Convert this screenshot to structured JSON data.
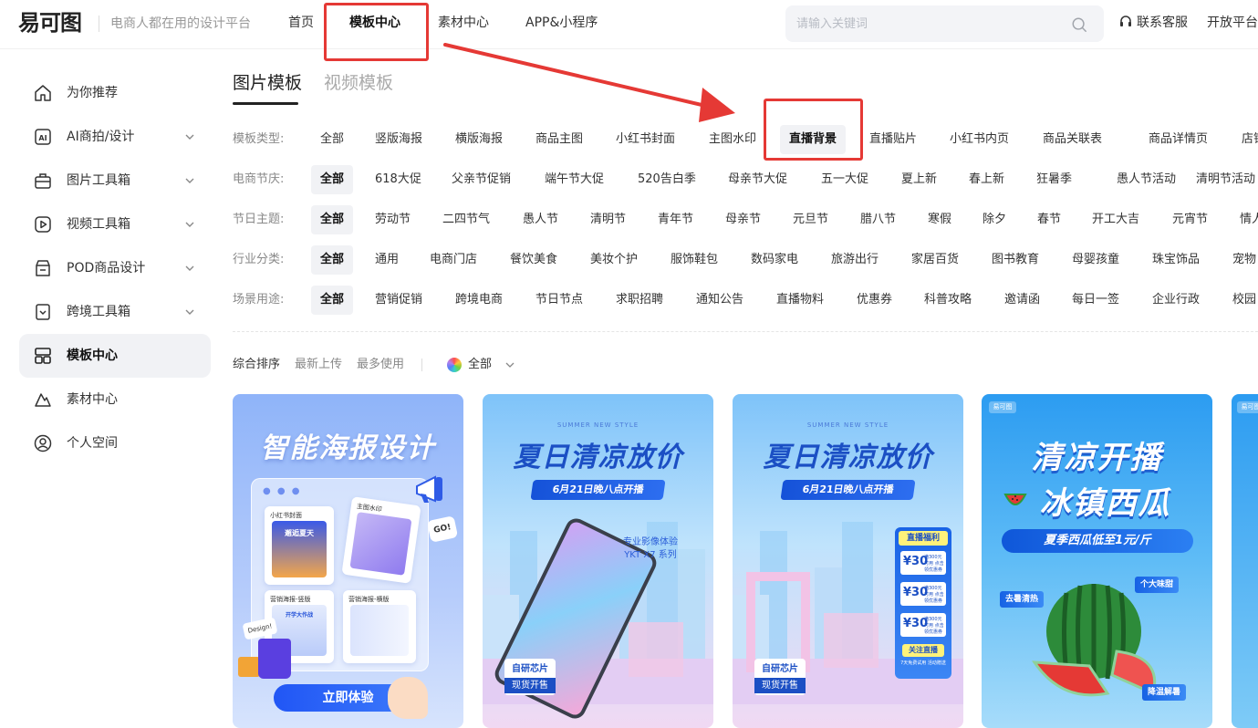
{
  "header": {
    "logo": "易可图",
    "slogan": "电商人都在用的设计平台",
    "nav": [
      "首页",
      "模板中心",
      "素材中心",
      "APP&小程序"
    ],
    "active_nav": "模板中心",
    "search_placeholder": "请输入关键词",
    "service_label": "联系客服",
    "open_platform_label": "开放平台"
  },
  "sidebar": {
    "items": [
      {
        "label": "为你推荐",
        "icon": "home-icon",
        "expandable": false
      },
      {
        "label": "AI商拍/设计",
        "icon": "ai-icon",
        "expandable": true
      },
      {
        "label": "图片工具箱",
        "icon": "toolbox-icon",
        "expandable": true
      },
      {
        "label": "视频工具箱",
        "icon": "video-icon",
        "expandable": true
      },
      {
        "label": "POD商品设计",
        "icon": "pod-icon",
        "expandable": true
      },
      {
        "label": "跨境工具箱",
        "icon": "crossborder-icon",
        "expandable": true
      },
      {
        "label": "模板中心",
        "icon": "template-icon",
        "expandable": false,
        "active": true
      },
      {
        "label": "素材中心",
        "icon": "material-icon",
        "expandable": false
      },
      {
        "label": "个人空间",
        "icon": "user-icon",
        "expandable": false
      }
    ]
  },
  "main": {
    "tabs": [
      "图片模板",
      "视频模板"
    ],
    "active_tab": "图片模板",
    "filters": [
      {
        "label": "模板类型:",
        "options": [
          "全部",
          "竖版海报",
          "横版海报",
          "商品主图",
          "小红书封面",
          "主图水印",
          "直播背景",
          "直播贴片",
          "小红书内页",
          "商品关联表",
          "商品详情页",
          "店铺"
        ],
        "active": "直播背景"
      },
      {
        "label": "电商节庆:",
        "options": [
          "全部",
          "618大促",
          "父亲节促销",
          "端午节大促",
          "520告白季",
          "母亲节大促",
          "五一大促",
          "夏上新",
          "春上新",
          "狂暑季",
          "愚人节活动",
          "清明节活动"
        ],
        "active": "全部"
      },
      {
        "label": "节日主题:",
        "options": [
          "全部",
          "劳动节",
          "二四节气",
          "愚人节",
          "清明节",
          "青年节",
          "母亲节",
          "元旦节",
          "腊八节",
          "寒假",
          "除夕",
          "春节",
          "开工大吉",
          "元宵节",
          "情人"
        ],
        "active": "全部"
      },
      {
        "label": "行业分类:",
        "options": [
          "全部",
          "通用",
          "电商门店",
          "餐饮美食",
          "美妆个护",
          "服饰鞋包",
          "数码家电",
          "旅游出行",
          "家居百货",
          "图书教育",
          "母婴孩童",
          "珠宝饰品",
          "宠物"
        ],
        "active": "全部"
      },
      {
        "label": "场景用途:",
        "options": [
          "全部",
          "营销促销",
          "跨境电商",
          "节日节点",
          "求职招聘",
          "通知公告",
          "直播物料",
          "优惠券",
          "科普攻略",
          "邀请函",
          "每日一签",
          "企业行政",
          "校园"
        ],
        "active": "全部"
      }
    ],
    "sort": {
      "options": [
        "综合排序",
        "最新上传",
        "最多使用"
      ],
      "active": "综合排序",
      "color_label": "全部"
    }
  },
  "cards": [
    {
      "title": "智能海报设计",
      "mini_labels": [
        "小红书封面",
        "主图水印",
        "营销海报-竖版",
        "营销海报-横版"
      ],
      "mini_art_texts": [
        "邂逅夏天",
        "开学大作战"
      ],
      "go_tag": "GO!",
      "design_tag": "Design!",
      "cta": "立即体验"
    },
    {
      "subtitle": "SUMMER NEW STYLE",
      "title": "夏日清凉放价",
      "date": "6月21日晚八点开播",
      "phone_info_line1": "专业影像体验",
      "phone_info_line2": "YKT X7 系列",
      "chip_line1": "自研芯片",
      "chip_line2": "现货开售"
    },
    {
      "subtitle": "SUMMER NEW STYLE",
      "title": "夏日清凉放价",
      "date": "6月21日晚八点开播",
      "benefit_title": "直播福利",
      "coupons": [
        {
          "value": "¥30",
          "text": "满300元可用 点击领优惠券"
        },
        {
          "value": "¥30",
          "text": "满300元可用 点击领优惠券"
        },
        {
          "value": "¥30",
          "text": "满300元可用 点击领优惠券"
        }
      ],
      "follow_label": "关注直播",
      "follow_note": "7天免费试用 活动赠送",
      "chip_line1": "自研芯片",
      "chip_line2": "现货开售"
    },
    {
      "logo": "易可图",
      "title_line1": "清凉开播",
      "title_line2": "冰镇西瓜",
      "price": "夏季西瓜低至1元/斤",
      "tags": [
        "去暑清热",
        "个大味甜",
        "降温解暑"
      ]
    },
    {
      "logo": "易可图"
    }
  ],
  "annotations": {
    "highlight_color": "#e53935"
  }
}
